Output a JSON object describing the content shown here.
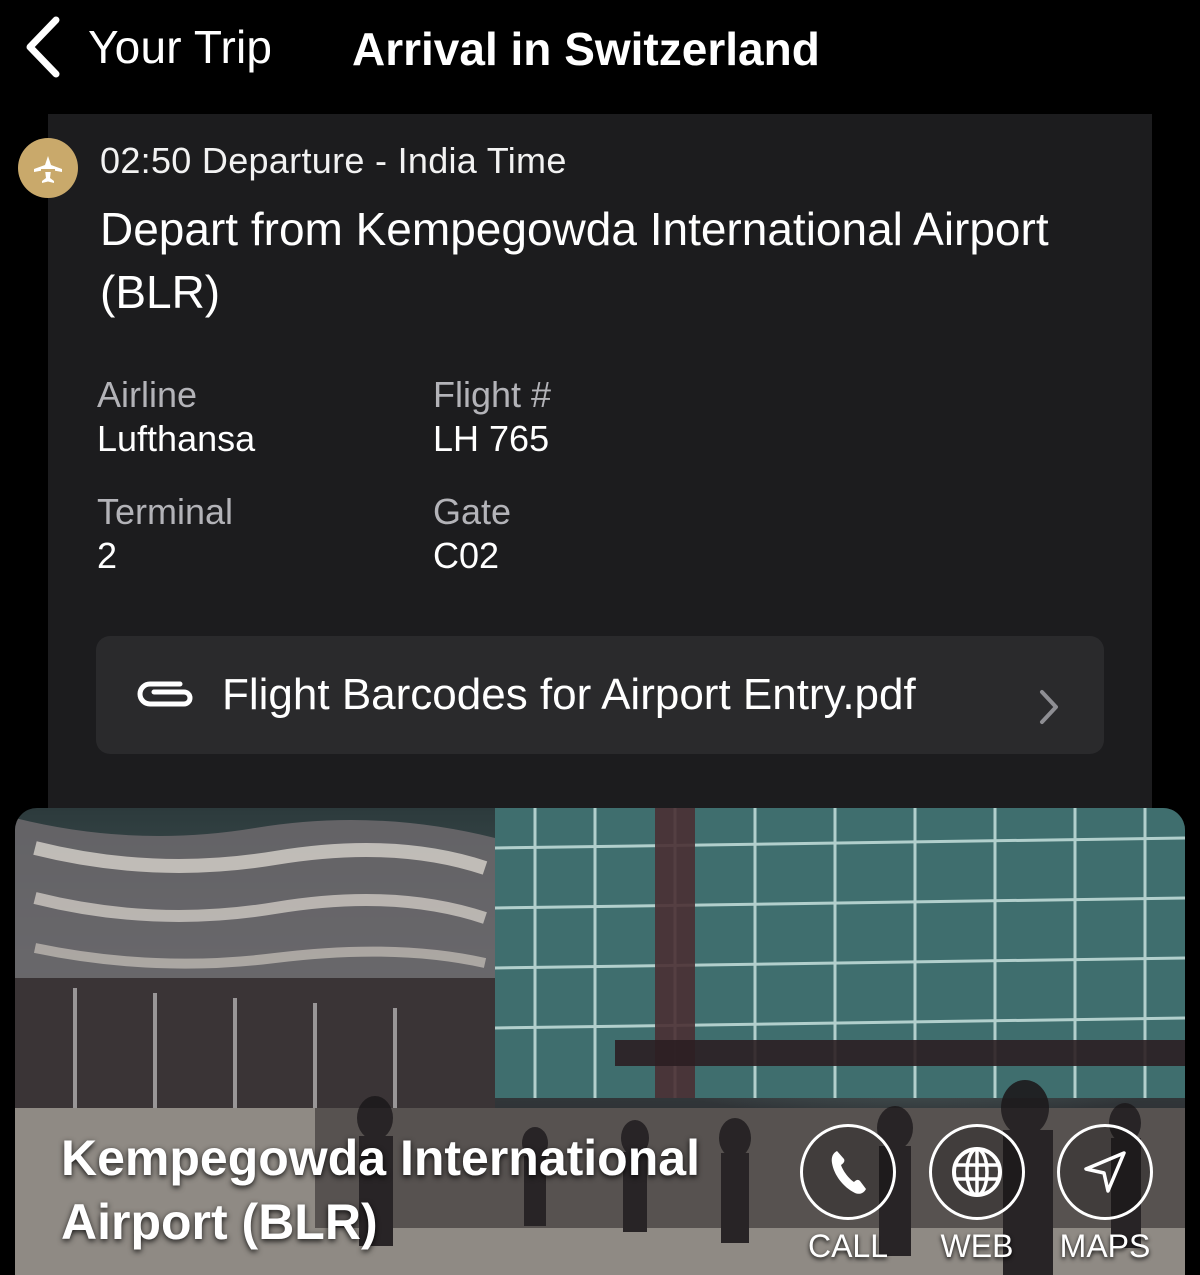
{
  "header": {
    "back_label": "Your Trip",
    "title": "Arrival in Switzerland"
  },
  "event": {
    "time_line": "02:50 Departure - India Time",
    "title": "Depart from Kempegowda International Airport (BLR)",
    "details": {
      "airline_label": "Airline",
      "airline_value": "Lufthansa",
      "flight_label": "Flight #",
      "flight_value": "LH 765",
      "terminal_label": "Terminal",
      "terminal_value": "2",
      "gate_label": "Gate",
      "gate_value": "C02"
    },
    "attachment": {
      "label": "Flight Barcodes for Airport Entry.pdf",
      "icon": "paperclip-icon"
    }
  },
  "place": {
    "name": "Kempegowda International Airport (BLR)",
    "actions": [
      {
        "label": "CALL",
        "icon": "phone-icon"
      },
      {
        "label": "WEB",
        "icon": "globe-icon"
      },
      {
        "label": "MAPS",
        "icon": "location-arrow-icon"
      }
    ]
  },
  "colors": {
    "background": "#000000",
    "card": "#1c1c1e",
    "attachment_bg": "#2a2a2c",
    "accent_gold": "#c9a96b",
    "label_gray": "#b3b3b8"
  }
}
